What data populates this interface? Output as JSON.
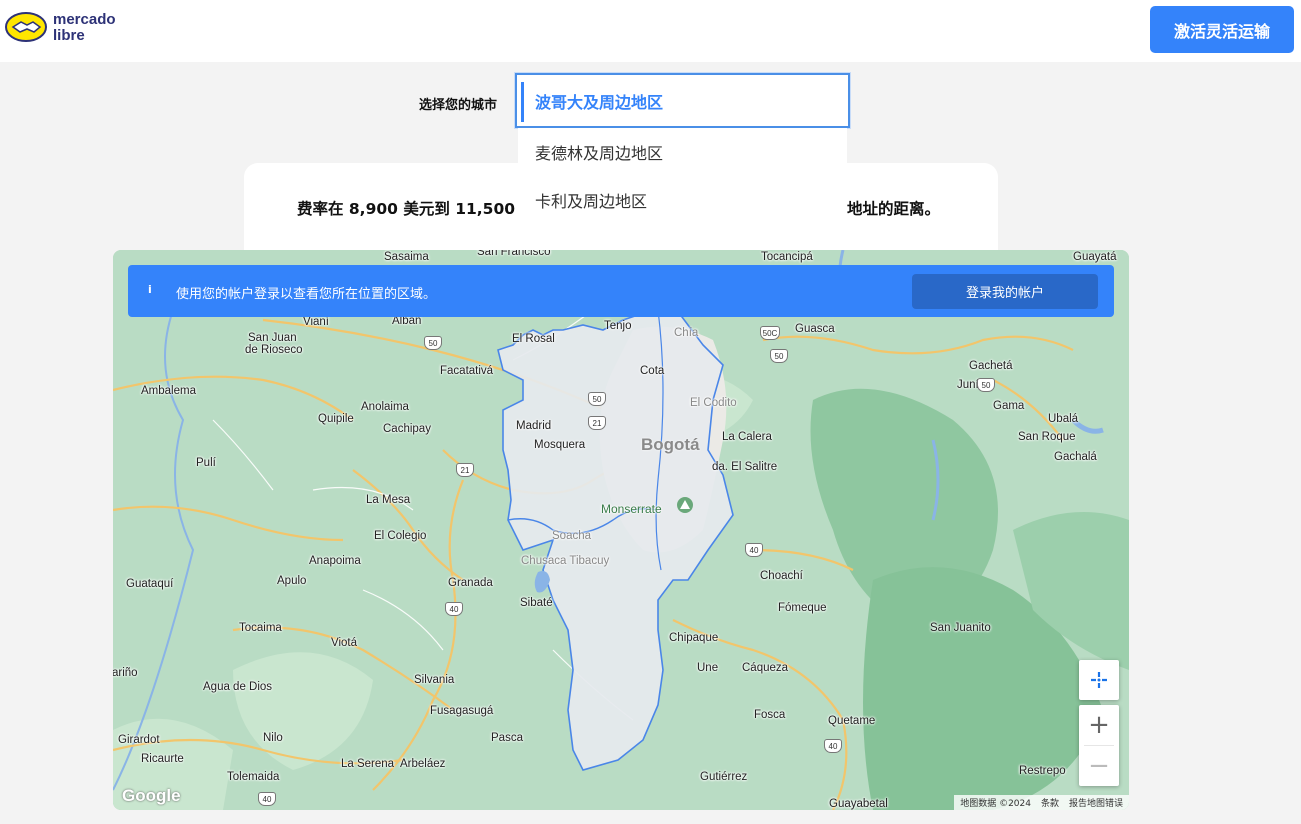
{
  "header": {
    "brand_line1": "mercado",
    "brand_line2": "libre",
    "activate_button": "激活灵活运输"
  },
  "city_selector": {
    "label": "选择您的城市",
    "selected": "波哥大及周边地区",
    "options": [
      "麦德林及周边地区",
      "卡利及周边地区"
    ]
  },
  "card": {
    "text_start": "费率在 8,900 美元到 11,500 美元",
    "text_end": "地址的距离。"
  },
  "banner": {
    "icon": "i",
    "text": "使用您的帐户登录以查看您所在位置的区域。",
    "button": "登录我的帐户"
  },
  "map": {
    "places": {
      "saasima": "Sasaima",
      "sanfrancisco": "San Francisco",
      "tocancipa": "Tocancipá",
      "guayata": "Guayatá",
      "viani": "Vianí",
      "alban": "Albán",
      "tenjo": "Tenjo",
      "chia": "Chía",
      "guasca": "Guasca",
      "sanjuan": "San Juan",
      "derioseco": "de Rioseco",
      "elrosal": "El Rosal",
      "gacheta": "Gachetá",
      "facatativa": "Facatativá",
      "cota": "Cota",
      "junin": "Junín",
      "ambalema": "Ambalema",
      "anolaima": "Anolaima",
      "elcodito": "El Codito",
      "gama": "Gama",
      "quipile": "Quipile",
      "madrid": "Madrid",
      "ubala": "Ubalá",
      "cachipay": "Cachipay",
      "mosquera": "Mosquera",
      "bogota": "Bogotá",
      "lacalera": "La Calera",
      "sanroque": "San Roque",
      "gachala": "Gachalá",
      "puli": "Pulí",
      "elsalitre": "da. El Salitre",
      "lamesa": "La Mesa",
      "monserrate": "Monserrate",
      "elcolegio": "El Colegio",
      "soacha": "Soacha",
      "chusaca": "Chusaca Tibacuy",
      "anapoima": "Anapoima",
      "choachi": "Choachí",
      "guataqui": "Guataquí",
      "apulo": "Apulo",
      "granada": "Granada",
      "sibate": "Sibaté",
      "fomeque": "Fómeque",
      "tocaima": "Tocaima",
      "chipaque": "Chipaque",
      "sanjuanito": "San Juanito",
      "viota": "Viotá",
      "une": "Une",
      "caqueza": "Cáqueza",
      "arino": "ariño",
      "aguadedios": "Agua de Dios",
      "silvania": "Silvania",
      "fusagasuga": "Fusagasugá",
      "fosca": "Fosca",
      "quetame": "Quetame",
      "girardot": "Girardot",
      "nilo": "Nilo",
      "pasca": "Pasca",
      "ricaurte": "Ricaurte",
      "laserena": "La Serena",
      "arbelaez": "Arbeláez",
      "restrepo": "Restrepo",
      "tolemaida": "Tolemaida",
      "gutierrez": "Gutiérrez",
      "guayabetal": "Guayabetal"
    },
    "shields": {
      "s50a": "50",
      "s50b": "50",
      "s50c": "50C",
      "s50d": "50",
      "s50e": "50",
      "s21a": "21",
      "s21b": "21",
      "s40a": "40",
      "s40b": "40",
      "s40c": "40",
      "s40d": "40"
    },
    "google": "Google",
    "attribution": [
      "地图数据 ©2024",
      "条款",
      "报告地图错误"
    ],
    "zoom_in": "+",
    "zoom_out": "−"
  },
  "colors": {
    "accent": "#3483fa",
    "map_green": "#b7dcc2",
    "zone_fill": "#e6e9ee",
    "zone_border": "#4a86e8"
  }
}
